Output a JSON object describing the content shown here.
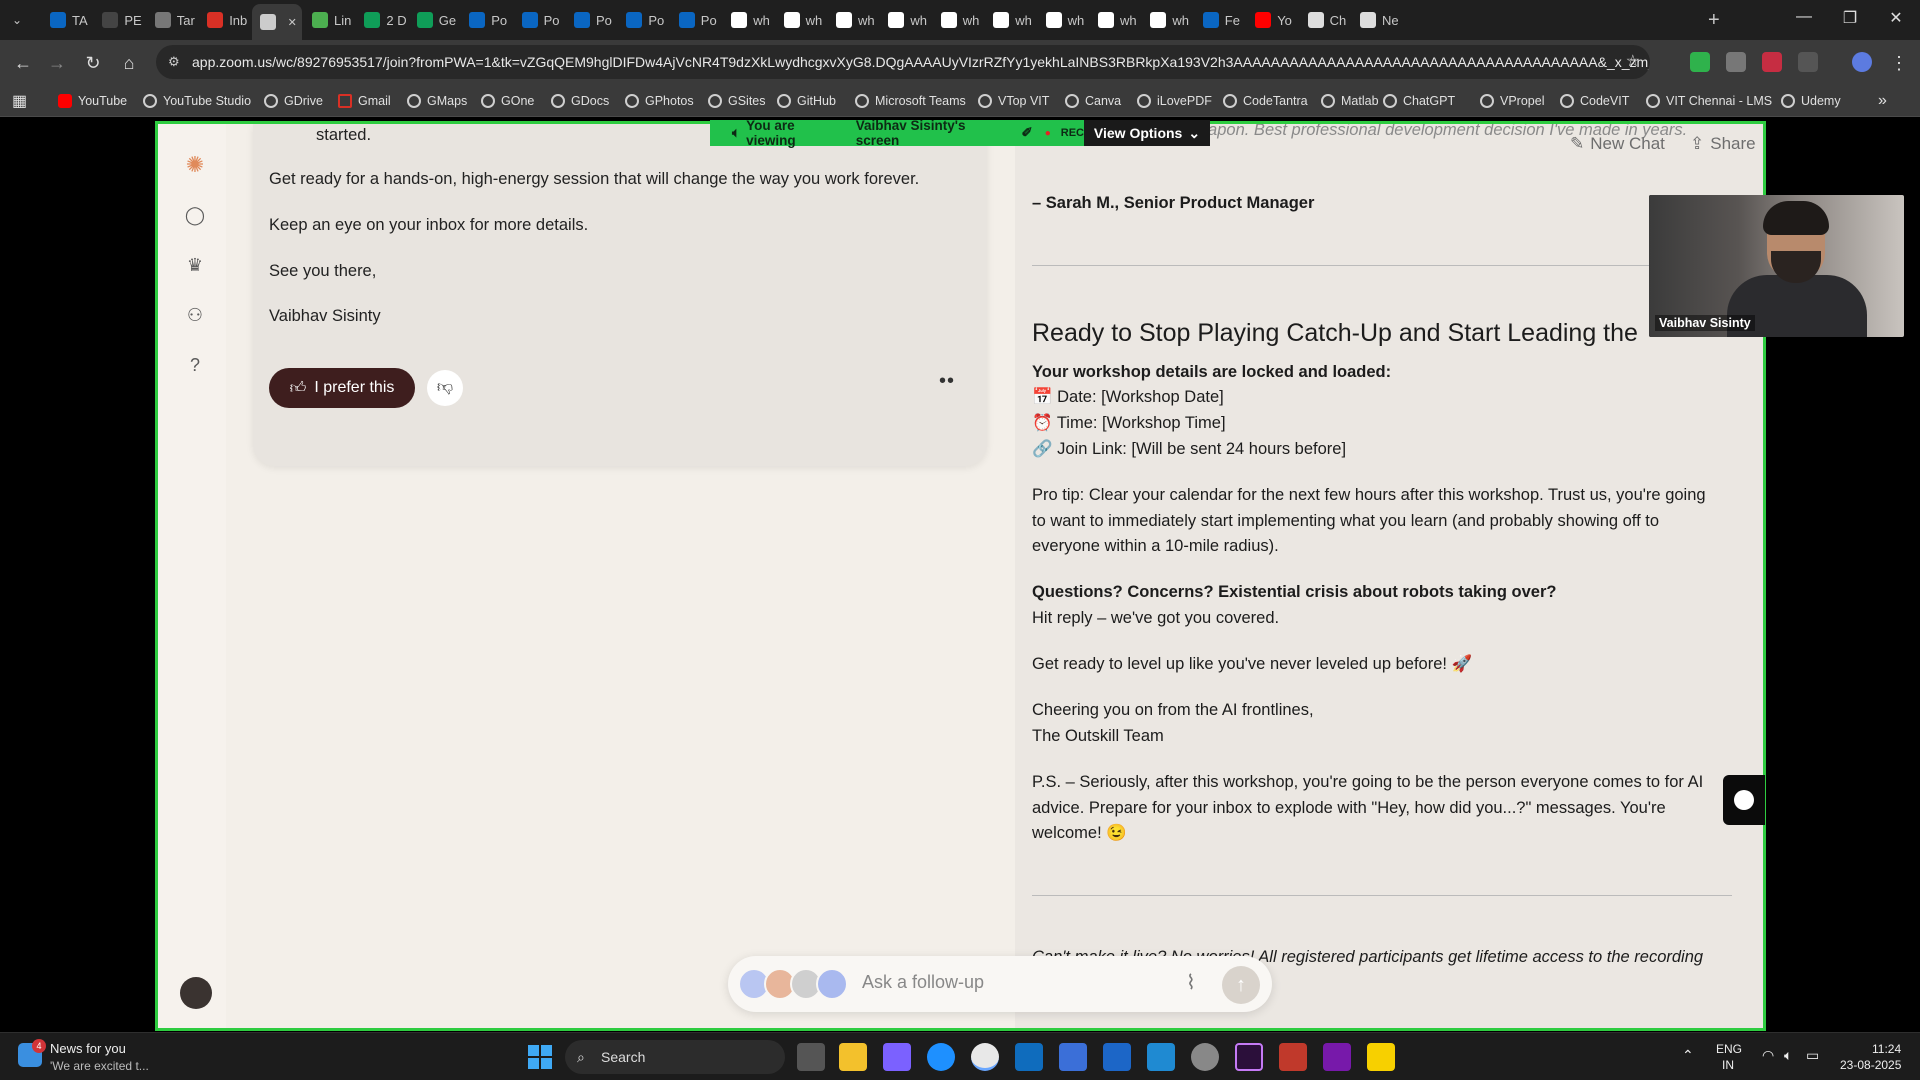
{
  "browser": {
    "tabs": [
      {
        "label": "TA",
        "icon": "linkedin-icon",
        "color": "#0a66c2"
      },
      {
        "label": "PE",
        "icon": "github-icon",
        "color": "#444444"
      },
      {
        "label": "Tar",
        "icon": "globe-icon",
        "color": "#777777"
      },
      {
        "label": "Inb",
        "icon": "gmail-icon",
        "color": "#d93025"
      },
      {
        "label": "",
        "icon": "audio-icon",
        "color": "#cccccc",
        "active": true
      },
      {
        "label": "Lin",
        "icon": "dots-icon",
        "color": "#4caf50"
      },
      {
        "label": "2 D",
        "icon": "sheets-icon",
        "color": "#0f9d58"
      },
      {
        "label": "Ge",
        "icon": "sheets-icon",
        "color": "#0f9d58"
      },
      {
        "label": "Po",
        "icon": "linkedin-icon",
        "color": "#0a66c2"
      },
      {
        "label": "Po",
        "icon": "linkedin-icon",
        "color": "#0a66c2"
      },
      {
        "label": "Po",
        "icon": "linkedin-icon",
        "color": "#0a66c2"
      },
      {
        "label": "Po",
        "icon": "linkedin-icon",
        "color": "#0a66c2"
      },
      {
        "label": "Po",
        "icon": "linkedin-icon",
        "color": "#0a66c2"
      },
      {
        "label": "wh",
        "icon": "google-icon",
        "color": "#ffffff"
      },
      {
        "label": "wh",
        "icon": "google-icon",
        "color": "#ffffff"
      },
      {
        "label": "wh",
        "icon": "google-icon",
        "color": "#ffffff"
      },
      {
        "label": "wh",
        "icon": "google-icon",
        "color": "#ffffff"
      },
      {
        "label": "wh",
        "icon": "google-icon",
        "color": "#ffffff"
      },
      {
        "label": "wh",
        "icon": "google-icon",
        "color": "#ffffff"
      },
      {
        "label": "wh",
        "icon": "google-icon",
        "color": "#ffffff"
      },
      {
        "label": "wh",
        "icon": "google-icon",
        "color": "#ffffff"
      },
      {
        "label": "wh",
        "icon": "google-icon",
        "color": "#ffffff"
      },
      {
        "label": "Fe",
        "icon": "linkedin-icon",
        "color": "#0a66c2"
      },
      {
        "label": "Yo",
        "icon": "youtube-icon",
        "color": "#ff0000"
      },
      {
        "label": "Ch",
        "icon": "chatgpt-icon",
        "color": "#dddddd"
      },
      {
        "label": "Ne",
        "icon": "chatgpt-icon",
        "color": "#dddddd"
      }
    ],
    "url": "app.zoom.us/wc/89276953517/join?fromPWA=1&tk=vZGqQEM9hglDIFDw4AjVcNR4T9dzXkLwydhcgxvXyG8.DQgAAAAUyVIzrRZfYy1yekhLaINBS3RBRkpXa193V2h3AAAAAAAAAAAAAAAAAAAAAAAAAAAAAAAAAAAAAAA&_x_zm_r...",
    "bookmarks": [
      "YouTube",
      "YouTube Studio",
      "GDrive",
      "Gmail",
      "GMaps",
      "GOne",
      "GDocs",
      "GPhotos",
      "GSites",
      "GitHub",
      "Microsoft Teams",
      "VTop VIT",
      "Canva",
      "iLovePDF",
      "CodeTantra",
      "Matlab",
      "ChatGPT",
      "VPropel",
      "CodeVIT",
      "VIT Chennai - LMS",
      "Udemy"
    ]
  },
  "zoom": {
    "viewing_prefix": "You are viewing",
    "viewing_name": "Vaibhav Sisinty's screen",
    "rec": "REC",
    "view_options": "View Options",
    "participant_name": "Vaibhav Sisinty",
    "accent": "#2ecc40"
  },
  "app": {
    "new_chat": "New Chat",
    "share": "Share",
    "left": {
      "line0": "started.",
      "line1": "Get ready for a hands-on, high-energy session that will change the way you work forever.",
      "line2": "Keep an eye on your inbox for more details.",
      "line3": "See you there,",
      "line4": "Vaibhav Sisinty",
      "prefer": "I prefer this"
    },
    "right": {
      "cut_top": "using it as my secret weapon. Best professional development decision I've made in years.",
      "attribution": "– Sarah M., Senior Product Manager",
      "heading": "Ready to Stop Playing Catch-Up and Start Leading the",
      "details_intro": "Your workshop details are locked and loaded:",
      "date": "📅 Date: [Workshop Date]",
      "time": "⏰ Time: [Workshop Time]",
      "link": "🔗 Join Link: [Will be sent 24 hours before]",
      "protip1": "Pro tip: Clear your calendar for the next few hours after this workshop. Trust us, you're going",
      "protip2": "to want to immediately start implementing what you learn (and probably showing off to",
      "protip3": "everyone within a 10-mile radius).",
      "questions1": "Questions? Concerns? Existential crisis about robots taking over?",
      "questions2": "Hit reply – we've got you covered.",
      "levelup": "Get ready to level up like you've never leveled up before! 🚀",
      "cheer1": "Cheering you on from the AI frontlines,",
      "cheer2": "The Outskill Team",
      "ps1": "P.S. – Seriously, after this workshop, you're going to be the person everyone comes to for AI",
      "ps2": "advice. Prepare for your inbox to explode with \"Hey, how did you...?\" messages. You're",
      "ps3": "welcome! 😉",
      "bottom": "Can't make it live? No worries! All registered participants get lifetime access to the recording"
    },
    "ask_placeholder": "Ask a follow-up"
  },
  "taskbar": {
    "news_title": "News for you",
    "news_sub": "'We are excited t...",
    "news_badge": "4",
    "search": "Search",
    "lang1": "ENG",
    "lang2": "IN",
    "time": "11:24",
    "date": "23-08-2025"
  }
}
